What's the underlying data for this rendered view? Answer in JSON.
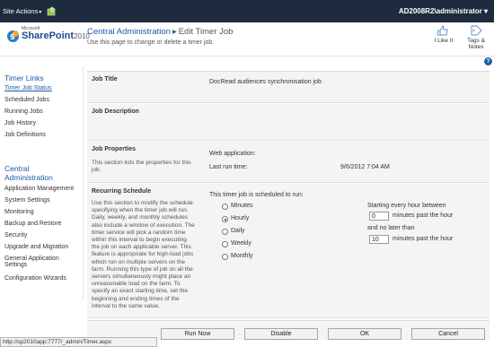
{
  "ribbon": {
    "site_actions": "Site Actions",
    "caret": "▾",
    "user": "AD2008R2\\administrator",
    "user_caret": "▾"
  },
  "logo": {
    "microsoft": "Microsoft",
    "sharepoint": "SharePoint",
    "year": "2010"
  },
  "breadcrumb": {
    "root": "Central Administration",
    "separator": "▸",
    "current": "Edit Timer Job"
  },
  "subtitle": "Use this page to change or delete a timer job.",
  "actions": {
    "like": "I Like It",
    "tags_line1": "Tags &",
    "tags_line2": "Notes"
  },
  "help": "?",
  "leftnav": {
    "timer_links_heading": "Timer Links",
    "timer_links": [
      "Timer Job Status",
      "Scheduled Jobs",
      "Running Jobs",
      "Job History",
      "Job Definitions"
    ],
    "ca_heading_line1": "Central",
    "ca_heading_line2": "Administration",
    "ca_links": [
      "Application Management",
      "System Settings",
      "Monitoring",
      "Backup and Restore",
      "Security",
      "Upgrade and Migration"
    ],
    "general_line1": "General Application",
    "general_line2": "Settings",
    "config_wizards": "Configuration Wizards"
  },
  "form": {
    "job_title_label": "Job Title",
    "job_title_value": "DocRead audiences synchronisation job",
    "job_description_label": "Job Description",
    "job_properties_label": "Job Properties",
    "job_properties_desc_1": "This section lists the properties for this",
    "job_properties_desc_2": "job.",
    "web_application_label": "Web application:",
    "last_run_label": "Last run time:",
    "last_run_value": "9/6/2012 7:04 AM",
    "recurring_label": "Recurring Schedule",
    "recurring_desc": [
      "Use this section to modify the schedule",
      "specifying when the timer job will run.",
      "Daily, weekly, and monthly schedules",
      "also include a window of execution. The",
      "timer service will pick a random time",
      "within this interval to begin executing",
      "the job on each applicable server. This",
      "feature is appropriate for high-load jobs",
      "which run on multiple servers on the",
      "farm. Running this type of job on all the",
      "servers simultaneously might place an",
      "unreasonable load on the farm. To",
      "specify an exact starting time, set the",
      "beginning and ending times of the",
      "interval to the same value."
    ],
    "scheduled_to_run": "This timer job is scheduled to run:",
    "schedule_options": [
      "Minutes",
      "Hourly",
      "Daily",
      "Weekly",
      "Monthly"
    ],
    "selected_option": "Hourly",
    "starting_every": "Starting every hour between",
    "start_minutes": "0",
    "minutes_past_1": "minutes past the hour",
    "no_later_than": "and no later than",
    "end_minutes": "10",
    "minutes_past_2": "minutes past the hour"
  },
  "buttons": {
    "run_now": "Run Now",
    "disable": "Disable",
    "ok": "OK",
    "cancel": "Cancel"
  },
  "status_url": "http://sp2010app:7777/_admin/Timer.aspx",
  "colors": {
    "ribbon": "#1e2a3d",
    "link": "#1a5ba6",
    "section_bg": "#f4f4f4"
  }
}
